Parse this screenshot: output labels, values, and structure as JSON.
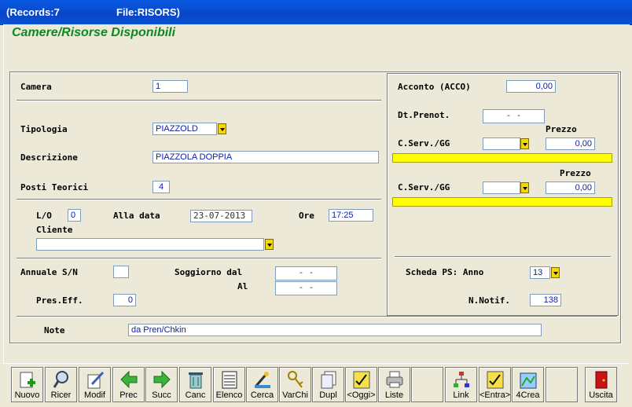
{
  "window": {
    "records": "(Records:7",
    "file": "File:RISORS)"
  },
  "heading": "Camere/Risorse Disponibili",
  "left": {
    "camera_label": "Camera",
    "camera_value": "1",
    "tipologia_label": "Tipologia",
    "tipologia_value": "PIAZZOLD",
    "descrizione_label": "Descrizione",
    "descrizione_value": "PIAZZOLA DOPPIA",
    "posti_label": "Posti Teorici",
    "posti_value": "4",
    "lo_label": "L/O",
    "lo_value": "0",
    "alla_data_label": "Alla data",
    "alla_data_value": "23-07-2013",
    "ore_label": "Ore",
    "ore_value": "17:25",
    "cliente_label": "Cliente",
    "cliente_value": "",
    "annuale_label": "Annuale S/N",
    "annuale_value": "",
    "soggiorno_label": "Soggiorno dal",
    "soggiorno_dal_value": "  -  -",
    "al_label": "Al",
    "al_value": "  -  -",
    "pres_label": "Pres.Eff.",
    "pres_value": "0",
    "note_label": "Note",
    "note_value": "da Pren/Chkin"
  },
  "right": {
    "acconto_label": "Acconto (ACCO)",
    "acconto_value": "0,00",
    "dtprenot_label": "Dt.Prenot.",
    "dtprenot_value": "  -  -",
    "prezzo1_label": "Prezzo",
    "cserv1_label": "C.Serv./GG",
    "cserv1_value": "",
    "prezzo1_value": "0,00",
    "prezzo2_label": "Prezzo",
    "cserv2_label": "C.Serv./GG",
    "cserv2_value": "",
    "prezzo2_value": "0,00",
    "scheda_label": "Scheda PS: Anno",
    "scheda_value": "13",
    "notif_label": "N.Notif.",
    "notif_value": "138"
  },
  "toolbar": [
    {
      "label": "Nuovo",
      "icon": "new-icon"
    },
    {
      "label": "Ricer",
      "icon": "search-icon"
    },
    {
      "label": "Modif",
      "icon": "edit-icon"
    },
    {
      "label": "Prec",
      "icon": "arrow-left-icon"
    },
    {
      "label": "Succ",
      "icon": "arrow-right-icon"
    },
    {
      "label": "Canc",
      "icon": "trash-icon"
    },
    {
      "label": "Elenco",
      "icon": "list-icon"
    },
    {
      "label": "Cerca",
      "icon": "find-icon"
    },
    {
      "label": "VarChi",
      "icon": "keys-icon"
    },
    {
      "label": "Dupl",
      "icon": "duplicate-icon"
    },
    {
      "label": "<Oggi>",
      "icon": "calendar-icon"
    },
    {
      "label": "Liste",
      "icon": "printer-icon"
    },
    {
      "label": "",
      "icon": ""
    },
    {
      "label": "Link",
      "icon": "link-icon"
    },
    {
      "label": "<Entra>",
      "icon": "calendar-enter-icon"
    },
    {
      "label": "4Crea",
      "icon": "create-icon"
    },
    {
      "label": "",
      "icon": ""
    },
    {
      "label": "Uscita",
      "icon": "exit-icon"
    }
  ]
}
